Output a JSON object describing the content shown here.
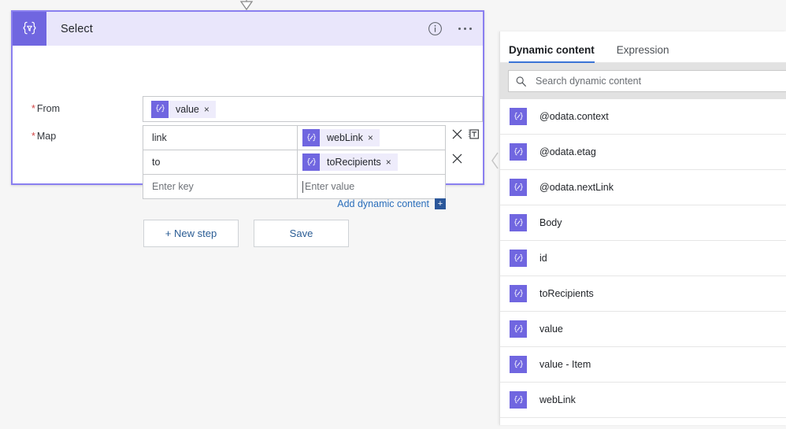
{
  "card": {
    "title": "Select",
    "icon_name": "select-action-icon",
    "info_icon": "info-icon",
    "more_icon": "ellipsis-icon",
    "fields": {
      "from": {
        "label": "From",
        "required_marker": "*",
        "token": {
          "label": "value",
          "remove": "×",
          "icon": "dynamic-content-token-icon"
        }
      },
      "map": {
        "label": "Map",
        "required_marker": "*",
        "rows": [
          {
            "key": "link",
            "value_token": {
              "label": "webLink",
              "remove": "×"
            },
            "has_delete": true,
            "has_text_mode": true
          },
          {
            "key": "to",
            "value_token": {
              "label": "toRecipients",
              "remove": "×"
            },
            "has_delete": true,
            "has_text_mode": false
          },
          {
            "key_placeholder": "Enter key",
            "value_placeholder": "Enter value",
            "has_delete": false,
            "has_text_mode": false
          }
        ]
      }
    },
    "add_dynamic_content": {
      "label": "Add dynamic content",
      "plus": "+"
    }
  },
  "actions": {
    "new_step": "+ New step",
    "save": "Save"
  },
  "dynamic_panel": {
    "tabs": [
      {
        "label": "Dynamic content",
        "active": true
      },
      {
        "label": "Expression",
        "active": false
      }
    ],
    "search": {
      "placeholder": "Search dynamic content",
      "value": "",
      "icon": "search-icon"
    },
    "items": [
      {
        "label": "@odata.context"
      },
      {
        "label": "@odata.etag"
      },
      {
        "label": "@odata.nextLink"
      },
      {
        "label": "Body"
      },
      {
        "label": "id"
      },
      {
        "label": "toRecipients"
      },
      {
        "label": "value"
      },
      {
        "label": "value - Item"
      },
      {
        "label": "webLink"
      }
    ],
    "collapse_icon": "chevron-left-icon"
  },
  "colors": {
    "accent_purple": "#7066e0",
    "card_border": "#8a7ff0",
    "header_bg": "#e9e6fb",
    "chip_bg": "#eeecfb",
    "tab_underline": "#3a74d6",
    "link_blue": "#2a6ebb",
    "required_red": "#d14545",
    "plus_badge": "#2b579a"
  }
}
